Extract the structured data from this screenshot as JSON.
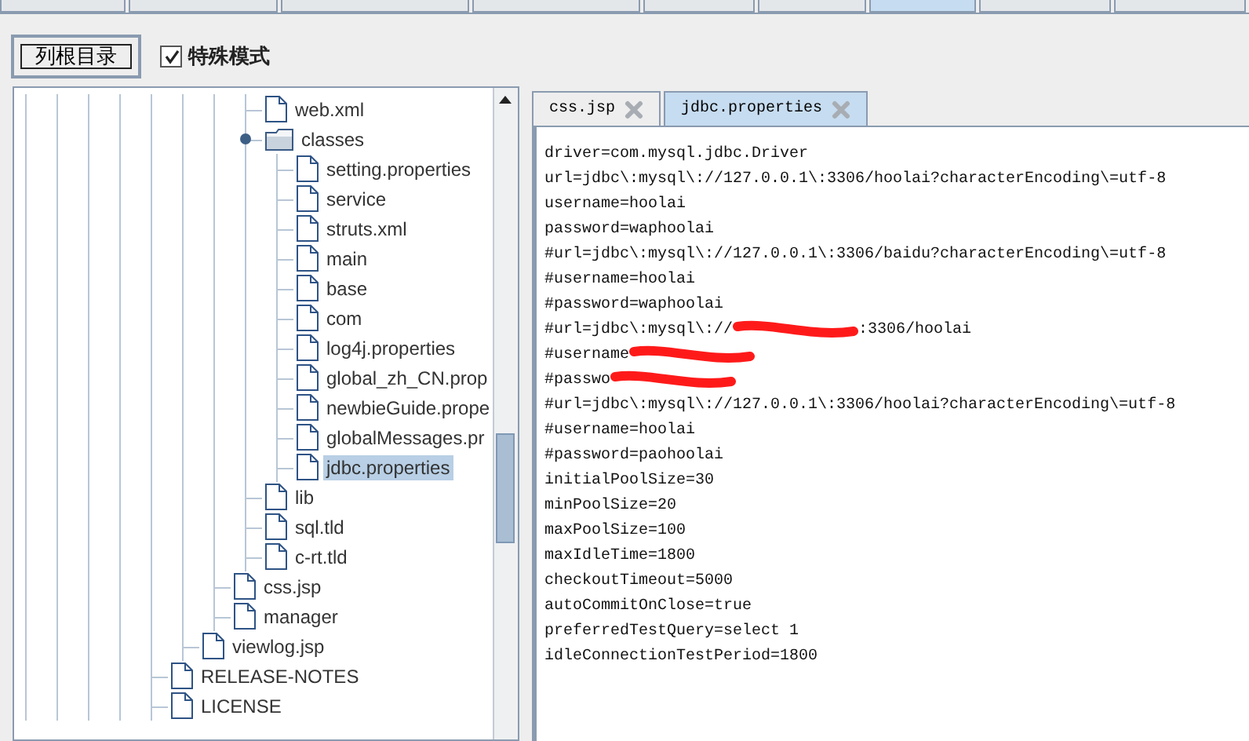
{
  "top_tabs": [
    {
      "selected": false
    },
    {
      "selected": false
    },
    {
      "selected": false
    },
    {
      "selected": false
    },
    {
      "selected": false
    },
    {
      "selected": false
    },
    {
      "selected": true
    },
    {
      "selected": false
    },
    {
      "selected": false
    }
  ],
  "toolbar": {
    "button": "列根目录",
    "checkbox": {
      "label": "特殊模式",
      "checked": true
    }
  },
  "tree": [
    {
      "children": [
        {
          "children": [
            {
              "children": [
                {
                  "label": "web.xml",
                  "selected": false
                },
                {
                  "label": "classes",
                  "folder": true,
                  "expanded": true,
                  "selected": false,
                  "children": [
                    {
                      "label": "setting.properties",
                      "selected": false
                    },
                    {
                      "label": "service",
                      "selected": false
                    },
                    {
                      "label": "struts.xml",
                      "selected": false
                    },
                    {
                      "label": "main",
                      "selected": false
                    },
                    {
                      "label": "base",
                      "selected": false
                    },
                    {
                      "label": "com",
                      "selected": false
                    },
                    {
                      "label": "log4j.properties",
                      "selected": false
                    },
                    {
                      "label": "global_zh_CN.prop",
                      "selected": false
                    },
                    {
                      "label": "newbieGuide.prope",
                      "selected": false
                    },
                    {
                      "label": "globalMessages.pr",
                      "selected": false
                    },
                    {
                      "label": "jdbc.properties",
                      "selected": true
                    }
                  ]
                },
                {
                  "label": "lib",
                  "selected": false
                },
                {
                  "label": "sql.tld",
                  "selected": false
                },
                {
                  "label": "c-rt.tld",
                  "selected": false
                }
              ]
            },
            {
              "label": "css.jsp",
              "selected": false
            },
            {
              "label": "manager",
              "selected": false
            }
          ]
        },
        {
          "label": "viewlog.jsp",
          "selected": false
        }
      ]
    },
    {
      "label": "RELEASE-NOTES",
      "selected": false
    },
    {
      "label": "LICENSE",
      "selected": false
    }
  ],
  "editor_tabs": [
    {
      "label": "css.jsp",
      "selected": false
    },
    {
      "label": "jdbc.properties",
      "selected": true
    }
  ],
  "editor_lines": [
    {
      "parts": [
        "driver=com.mysql.jdbc.Driver"
      ],
      "redacted": false
    },
    {
      "parts": [
        "url=jdbc\\:mysql\\://127.0.0.1\\:3306/hoolai?characterEncoding\\=utf-8"
      ],
      "redacted": false
    },
    {
      "parts": [
        "username=hoolai"
      ],
      "redacted": false
    },
    {
      "parts": [
        "password=waphoolai"
      ],
      "redacted": false
    },
    {
      "parts": [
        "#url=jdbc\\:mysql\\://127.0.0.1\\:3306/baidu?characterEncoding\\=utf-8"
      ],
      "redacted": false
    },
    {
      "parts": [
        "#username=hoolai"
      ],
      "redacted": false
    },
    {
      "parts": [
        "#password=waphoolai"
      ],
      "redacted": false
    },
    {
      "parts": [
        "#url=jdbc\\:mysql\\://",
        ":3306/hoolai"
      ],
      "redacted": true
    },
    {
      "parts": [
        "#username"
      ],
      "redacted": true
    },
    {
      "parts": [
        "#passwo"
      ],
      "redacted": true
    },
    {
      "parts": [
        "#url=jdbc\\:mysql\\://127.0.0.1\\:3306/hoolai?characterEncoding\\=utf-8"
      ],
      "redacted": false
    },
    {
      "parts": [
        "#username=hoolai"
      ],
      "redacted": false
    },
    {
      "parts": [
        "#password=paohoolai"
      ],
      "redacted": false
    },
    {
      "parts": [
        "initialPoolSize=30"
      ],
      "redacted": false
    },
    {
      "parts": [
        "minPoolSize=20"
      ],
      "redacted": false
    },
    {
      "parts": [
        "maxPoolSize=100"
      ],
      "redacted": false
    },
    {
      "parts": [
        "maxIdleTime=1800"
      ],
      "redacted": false
    },
    {
      "parts": [
        "checkoutTimeout=5000"
      ],
      "redacted": false
    },
    {
      "parts": [
        "autoCommitOnClose=true"
      ],
      "redacted": false
    },
    {
      "parts": [
        "preferredTestQuery=select 1"
      ],
      "redacted": false
    },
    {
      "parts": [
        "idleConnectionTestPeriod=1800"
      ],
      "redacted": false
    }
  ]
}
